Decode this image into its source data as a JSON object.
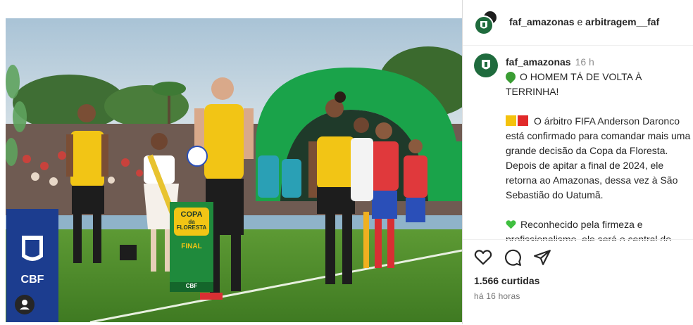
{
  "header": {
    "account": "faf_amazonas",
    "connector": "e",
    "collaborator": "arbitragem__faf"
  },
  "caption": {
    "username": "faf_amazonas",
    "time": "16 h",
    "line1": "O HOMEM TÁ DE VOLTA À TERRINHA!",
    "para2": "O árbitro FIFA Anderson Daronco está confirmado para comandar mais uma grande decisão da Copa da Floresta. Depois de apitar a final de 2024, ele retorna ao Amazonas, dessa vez à São Sebastião do Uatumã.",
    "para3": "Reconhecido pela firmeza e profissionalismo, ele será o central do duelo entre as seleções de Uatumã e"
  },
  "photo": {
    "sign_line1": "COPA",
    "sign_line2": "da",
    "sign_line3": "FLORESTA",
    "sign_final": "FINAL",
    "sign_cbf": "CBF",
    "banner_cbf": "CBF"
  },
  "actions": {
    "likes": "1.566 curtidas",
    "posted": "há 16 horas"
  },
  "colors": {
    "brand_green": "#1f6b3d",
    "referee_yellow": "#f2c515",
    "grass": "#4e8a2a",
    "inflatable_green": "#1aa34a"
  }
}
